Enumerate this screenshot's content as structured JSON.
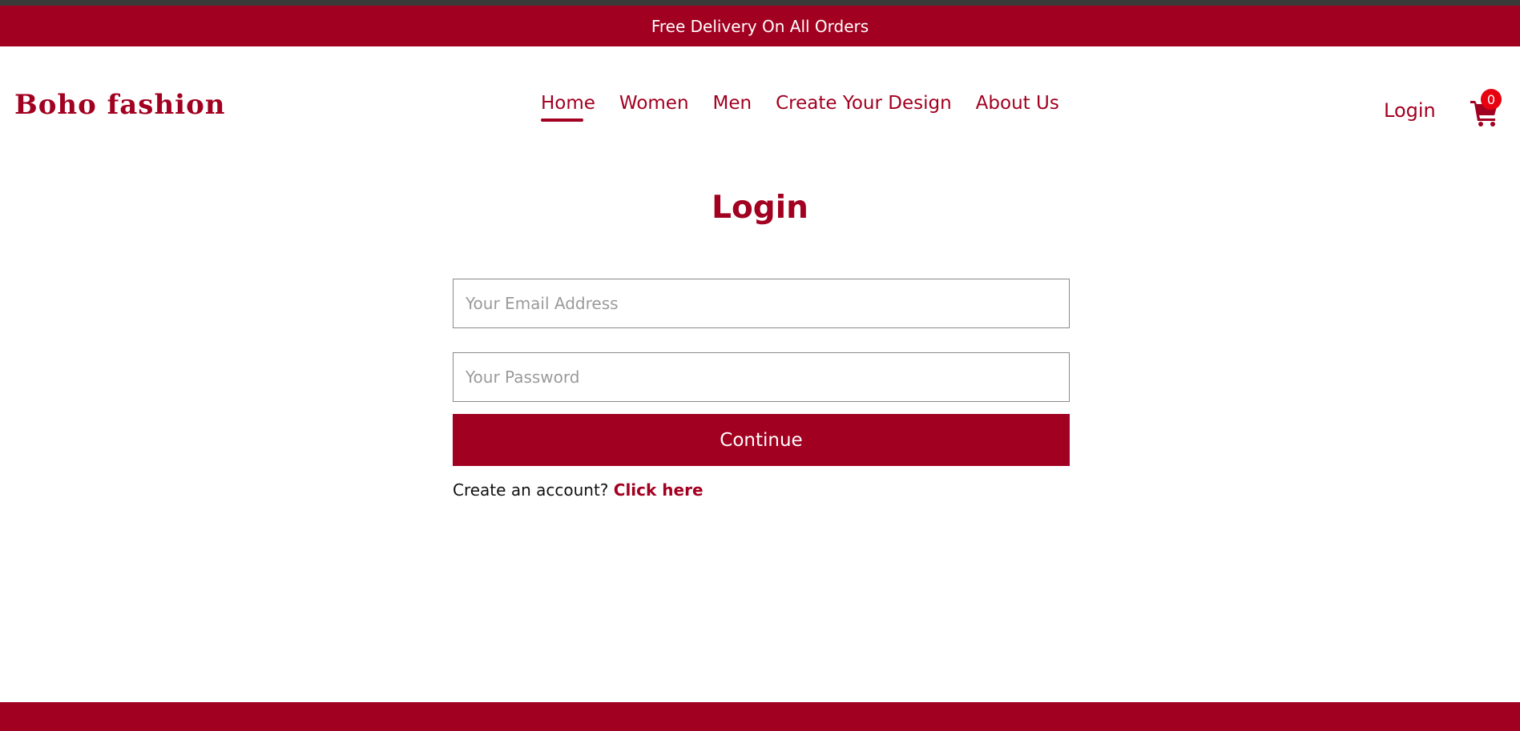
{
  "promo": {
    "text": "Free Delivery On All Orders"
  },
  "brand": {
    "name": "Boho fashion",
    "color": "#a20020"
  },
  "nav": {
    "items": [
      {
        "label": "Home",
        "active": true
      },
      {
        "label": "Women",
        "active": false
      },
      {
        "label": "Men",
        "active": false
      },
      {
        "label": "Create Your Design",
        "active": false
      },
      {
        "label": "About Us",
        "active": false
      }
    ]
  },
  "header": {
    "login_label": "Login",
    "cart_icon": "shopping-cart-icon",
    "cart_count": "0"
  },
  "login_form": {
    "title": "Login",
    "email_placeholder": "Your Email Address",
    "email_value": "",
    "password_placeholder": "Your Password",
    "password_value": "",
    "continue_label": "Continue",
    "signup_prompt": "Create an account?",
    "signup_link": "Click here"
  },
  "colors": {
    "accent": "#a20020",
    "badge": "#e80010",
    "background": "#ffffff"
  }
}
